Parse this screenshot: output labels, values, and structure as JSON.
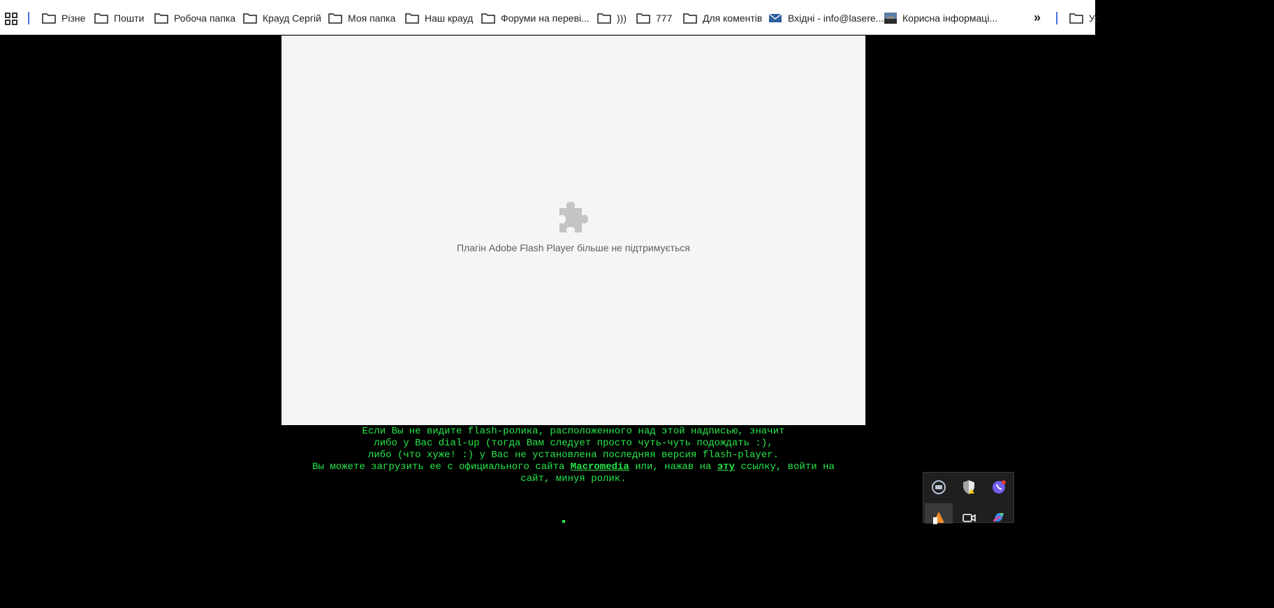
{
  "bookmarks": {
    "items": [
      {
        "label": "Різне",
        "icon": "folder-icon"
      },
      {
        "label": "Пошти",
        "icon": "folder-icon"
      },
      {
        "label": "Робоча папка",
        "icon": "folder-icon"
      },
      {
        "label": "Крауд Сергій",
        "icon": "folder-icon"
      },
      {
        "label": "Моя папка",
        "icon": "folder-icon"
      },
      {
        "label": "Наш крауд",
        "icon": "folder-icon"
      },
      {
        "label": "Форуми на переві...",
        "icon": "folder-icon"
      },
      {
        "label": ")))",
        "icon": "folder-icon"
      },
      {
        "label": "777",
        "icon": "folder-icon"
      },
      {
        "label": "Для коментів",
        "icon": "folder-icon"
      },
      {
        "label": "Вхідні - info@lasere...",
        "icon": "mail-icon"
      },
      {
        "label": "Корисна інформаці...",
        "icon": "image-thumbnail-icon"
      },
      {
        "label": "Ус",
        "icon": "folder-icon"
      }
    ],
    "more": "»"
  },
  "flash": {
    "message": "Плагін Adobe Flash Player більше не підтримується",
    "icon": "puzzle-icon"
  },
  "notice": {
    "line1": "Если Вы не видите flash-ролика, расположенного над этой надписью, значит",
    "line2": "либо у Вас dial-up (тогда Вам следует просто чуть-чуть подождать :),",
    "line3": "либо (что хуже! :) у Вас не установлена последняя версия flash-player.",
    "line4_pre": "Вы можете загрузить ее с официального сайта ",
    "link_macromedia": "Macromedia",
    "line4_mid": " или, нажав на ",
    "link_this": "эту",
    "line4_post": " ссылку, войти на",
    "line5": "сайт, минуя ролик."
  },
  "tray": {
    "icons": [
      "vpn-shield-icon",
      "security-warning-icon",
      "viber-icon",
      "app-orange-icon",
      "camera-icon",
      "copilot-icon"
    ]
  },
  "colors": {
    "notice_green": "#27e84a",
    "background": "#000000",
    "flash_bg": "#f5f5f5"
  }
}
